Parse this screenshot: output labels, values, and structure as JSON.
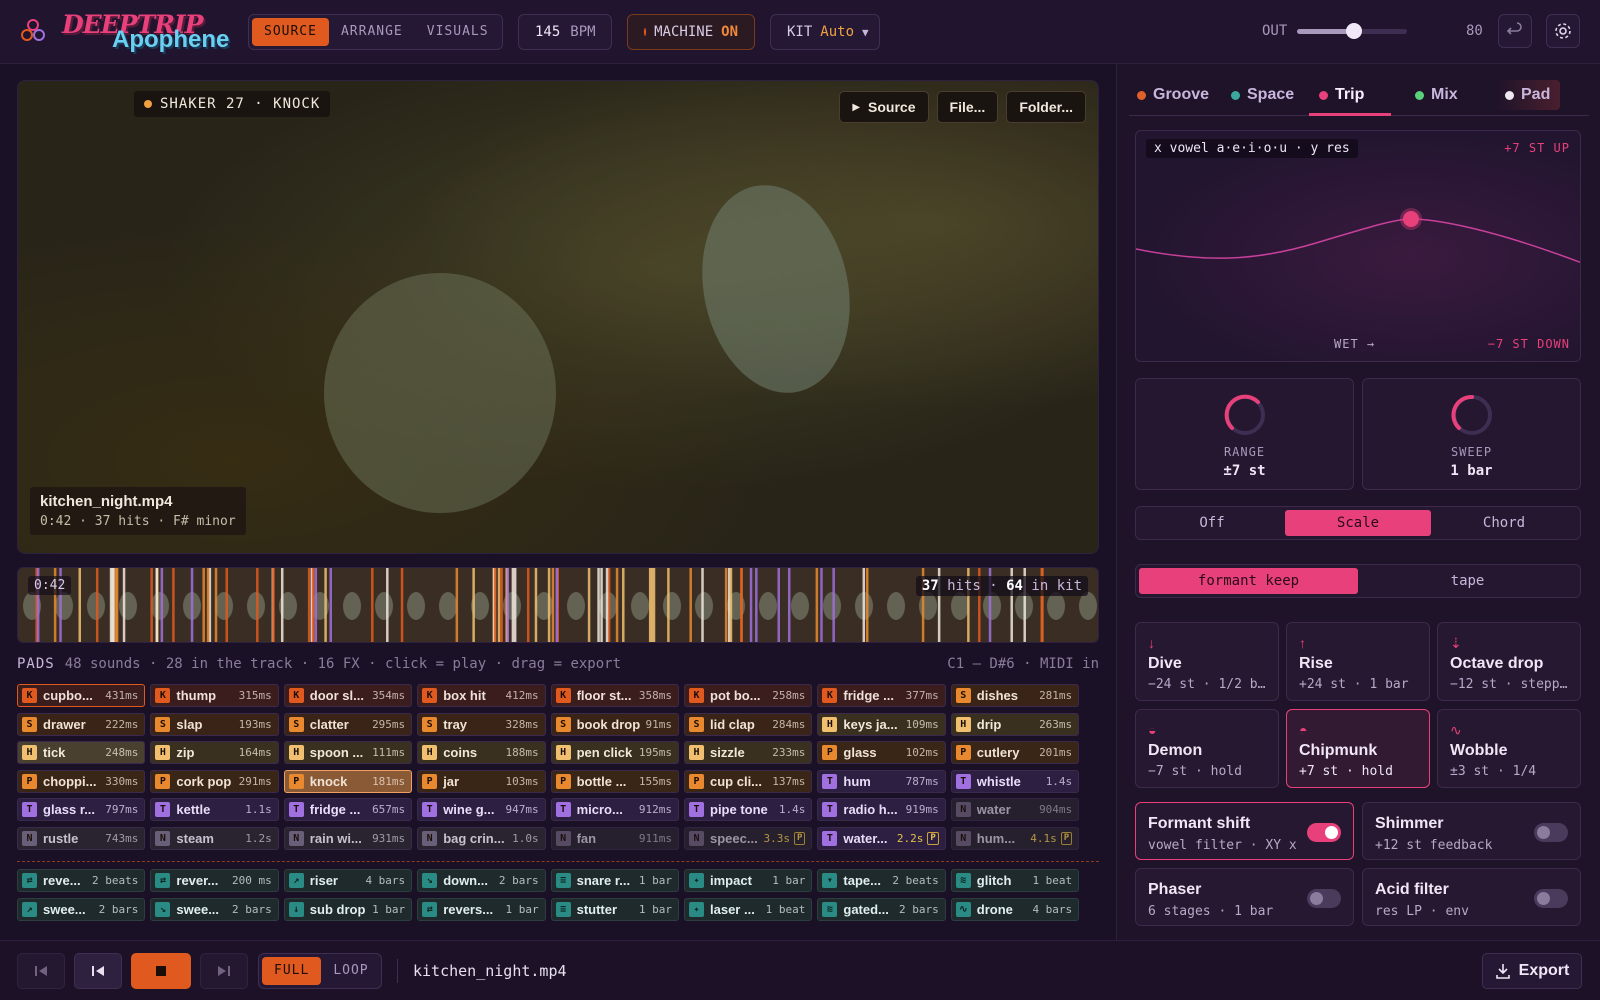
{
  "app": {
    "logo_line1": "DEEPTRIP",
    "logo_line2": "Apophene"
  },
  "header": {
    "modes": [
      "SOURCE",
      "ARRANGE",
      "VISUALS"
    ],
    "bpm_value": "145",
    "bpm_unit": "BPM",
    "machine_label": "MACHINE",
    "machine_state": "ON",
    "kit_label": "KIT",
    "kit_value": "Auto",
    "out_label": "OUT",
    "out_value": "80",
    "out_level": 0.52
  },
  "video": {
    "now_playing": "SHAKER 27 · KNOCK",
    "source_btn": "Source",
    "file_btn": "File...",
    "folder_btn": "Folder...",
    "filename": "kitchen_night.mp4",
    "meta": "0:42 · 37 hits · F# minor"
  },
  "strip": {
    "time": "0:42",
    "hits_num": "37",
    "hits_label": "hits",
    "kit_num": "64",
    "kit_label": "in kit"
  },
  "pads": {
    "title": "PADS",
    "summary": "48 sounds · 28 in the track · 16 FX · click = play · drag = export",
    "range": "C1 – D#6 · MIDI in",
    "rows": [
      [
        {
          "b": "K",
          "n": "cupbo...",
          "d": "431ms"
        },
        {
          "b": "K",
          "n": "thump",
          "d": "315ms"
        },
        {
          "b": "K",
          "n": "door sl...",
          "d": "354ms"
        },
        {
          "b": "K",
          "n": "box hit",
          "d": "412ms"
        },
        {
          "b": "K",
          "n": "floor st...",
          "d": "358ms"
        },
        {
          "b": "K",
          "n": "pot bo...",
          "d": "258ms"
        },
        {
          "b": "K",
          "n": "fridge ...",
          "d": "377ms"
        },
        {
          "b": "S",
          "n": "dishes",
          "d": "281ms"
        }
      ],
      [
        {
          "b": "S",
          "n": "drawer",
          "d": "222ms"
        },
        {
          "b": "S",
          "n": "slap",
          "d": "193ms"
        },
        {
          "b": "S",
          "n": "clatter",
          "d": "295ms"
        },
        {
          "b": "S",
          "n": "tray",
          "d": "328ms"
        },
        {
          "b": "S",
          "n": "book drop",
          "d": "91ms"
        },
        {
          "b": "S",
          "n": "lid clap",
          "d": "284ms"
        },
        {
          "b": "H",
          "n": "keys ja...",
          "d": "109ms"
        },
        {
          "b": "H",
          "n": "drip",
          "d": "263ms"
        }
      ],
      [
        {
          "b": "H",
          "n": "tick",
          "d": "248ms"
        },
        {
          "b": "H",
          "n": "zip",
          "d": "164ms"
        },
        {
          "b": "H",
          "n": "spoon ...",
          "d": "111ms"
        },
        {
          "b": "H",
          "n": "coins",
          "d": "188ms"
        },
        {
          "b": "H",
          "n": "pen click",
          "d": "195ms"
        },
        {
          "b": "H",
          "n": "sizzle",
          "d": "233ms"
        },
        {
          "b": "P",
          "n": "glass",
          "d": "102ms"
        },
        {
          "b": "P",
          "n": "cutlery",
          "d": "201ms"
        }
      ],
      [
        {
          "b": "P",
          "n": "choppi...",
          "d": "330ms"
        },
        {
          "b": "P",
          "n": "cork pop",
          "d": "291ms"
        },
        {
          "b": "P",
          "n": "knock",
          "d": "181ms"
        },
        {
          "b": "P",
          "n": "jar",
          "d": "103ms"
        },
        {
          "b": "P",
          "n": "bottle ...",
          "d": "155ms"
        },
        {
          "b": "P",
          "n": "cup cli...",
          "d": "137ms"
        },
        {
          "b": "T",
          "n": "hum",
          "d": "787ms"
        },
        {
          "b": "T",
          "n": "whistle",
          "d": "1.4s"
        }
      ],
      [
        {
          "b": "T",
          "n": "glass r...",
          "d": "797ms"
        },
        {
          "b": "T",
          "n": "kettle",
          "d": "1.1s"
        },
        {
          "b": "T",
          "n": "fridge ...",
          "d": "657ms"
        },
        {
          "b": "T",
          "n": "wine g...",
          "d": "947ms"
        },
        {
          "b": "T",
          "n": "micro...",
          "d": "912ms"
        },
        {
          "b": "T",
          "n": "pipe tone",
          "d": "1.4s"
        },
        {
          "b": "T",
          "n": "radio h...",
          "d": "919ms"
        },
        {
          "b": "N",
          "n": "water",
          "d": "904ms"
        }
      ],
      [
        {
          "b": "N",
          "n": "rustle",
          "d": "743ms"
        },
        {
          "b": "N",
          "n": "steam",
          "d": "1.2s"
        },
        {
          "b": "N",
          "n": "rain wi...",
          "d": "931ms"
        },
        {
          "b": "N",
          "n": "bag crin...",
          "d": "1.0s"
        },
        {
          "b": "N",
          "n": "fan",
          "d": "911ms"
        },
        {
          "b": "N",
          "n": "speec...",
          "d": "3.3s",
          "p": "P"
        },
        {
          "b": "T",
          "n": "water...",
          "d": "2.2s",
          "p": "P"
        },
        {
          "b": "N",
          "n": "hum...",
          "d": "4.1s",
          "p": "P"
        }
      ]
    ],
    "fx_rows": [
      [
        {
          "i": "⇄",
          "n": "reve...",
          "d": "2 beats"
        },
        {
          "i": "⇄",
          "n": "rever...",
          "d": "200 ms"
        },
        {
          "i": "↗",
          "n": "riser",
          "d": "4 bars"
        },
        {
          "i": "↘",
          "n": "down...",
          "d": "2 bars"
        },
        {
          "i": "≡",
          "n": "snare r...",
          "d": "1 bar"
        },
        {
          "i": "✦",
          "n": "impact",
          "d": "1 bar"
        },
        {
          "i": "▾",
          "n": "tape...",
          "d": "2 beats"
        },
        {
          "i": "≋",
          "n": "glitch",
          "d": "1 beat"
        }
      ],
      [
        {
          "i": "↗",
          "n": "swee...",
          "d": "2 bars"
        },
        {
          "i": "↘",
          "n": "swee...",
          "d": "2 bars"
        },
        {
          "i": "↓",
          "n": "sub drop",
          "d": "1 bar"
        },
        {
          "i": "⇄",
          "n": "revers...",
          "d": "1 bar"
        },
        {
          "i": "≡",
          "n": "stutter",
          "d": "1 bar"
        },
        {
          "i": "✦",
          "n": "laser ...",
          "d": "1 beat"
        },
        {
          "i": "≋",
          "n": "gated...",
          "d": "2 bars"
        },
        {
          "i": "∿",
          "n": "drone",
          "d": "4 bars"
        }
      ]
    ]
  },
  "right": {
    "tabs": [
      {
        "label": "Groove",
        "color": "#e0602a"
      },
      {
        "label": "Space",
        "color": "#3aa89a"
      },
      {
        "label": "Trip",
        "color": "#e8407a"
      },
      {
        "label": "Mix",
        "color": "#5ad07a"
      },
      {
        "label": "Pad",
        "color": "#f0e8f0"
      }
    ],
    "xy": {
      "label": "x vowel a·e·i·o·u · y res",
      "up": "+7 ST UP",
      "down": "−7 ST DOWN",
      "wet": "WET →"
    },
    "range_label": "RANGE",
    "range_value": "±7 st",
    "sweep_label": "SWEEP",
    "sweep_value": "1 bar",
    "modes": [
      "Off",
      "Scale",
      "Chord"
    ],
    "formant": [
      "formant keep",
      "tape"
    ],
    "presets": [
      {
        "icon": "↓",
        "title": "Dive",
        "sub": "−24 st · 1/2 b..."
      },
      {
        "icon": "↑",
        "title": "Rise",
        "sub": "+24 st · 1 bar"
      },
      {
        "icon": "⇣",
        "title": "Octave drop",
        "sub": "−12 st · stepp..."
      },
      {
        "icon": "◒",
        "title": "Demon",
        "sub": "−7 st · hold"
      },
      {
        "icon": "◓",
        "title": "Chipmunk",
        "sub": "+7 st · hold"
      },
      {
        "icon": "∿",
        "title": "Wobble",
        "sub": "±3 st · 1/4"
      }
    ],
    "toggles": [
      {
        "title": "Formant shift",
        "sub": "vowel filter · XY x",
        "on": true
      },
      {
        "title": "Shimmer",
        "sub": "+12 st feedback",
        "on": false
      },
      {
        "title": "Phaser",
        "sub": "6 stages · 1 bar",
        "on": false
      },
      {
        "title": "Acid filter",
        "sub": "res LP · env",
        "on": false
      }
    ]
  },
  "transport": {
    "full": "FULL",
    "loop": "LOOP",
    "filename": "kitchen_night.mp4",
    "export": "Export"
  },
  "colors": {
    "accent": "#e05a1f",
    "trip": "#e8407a",
    "K": "#e05a1f",
    "S": "#e8892f",
    "H": "#f0c070",
    "P": "#e8892f",
    "T": "#a070e0",
    "N": "#6a5f78",
    "fx": "#2aa898"
  }
}
